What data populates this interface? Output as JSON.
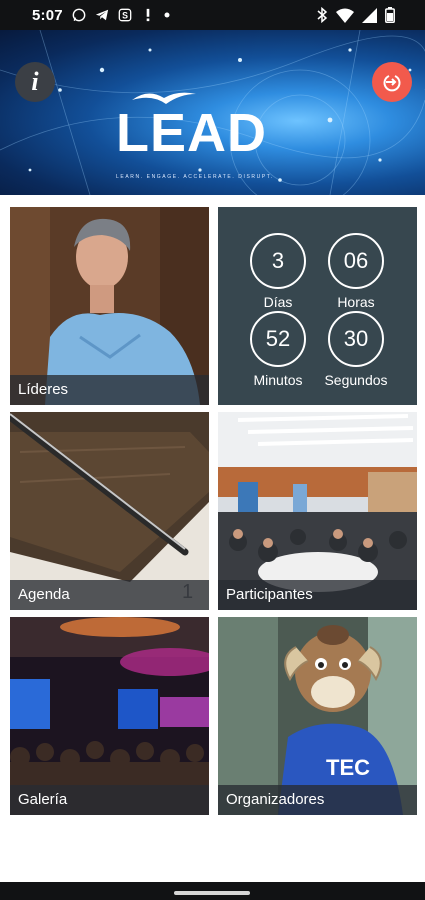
{
  "status_bar": {
    "time": "5:07",
    "left_icons": [
      "whatsapp-icon",
      "telegram-icon",
      "s-app-icon",
      "exclamation-icon",
      "dot-icon"
    ],
    "right_icons": [
      "bluetooth-icon",
      "wifi-icon",
      "signal-icon",
      "battery-icon"
    ]
  },
  "header": {
    "logo_text": "LEAD",
    "tagline": "LEARN. ENGAGE. ACCELERATE. DISRUPT.",
    "info_button": "i",
    "logout_icon": "logout-icon"
  },
  "countdown": {
    "days": "3",
    "days_label": "Días",
    "hours": "06",
    "hours_label": "Horas",
    "minutes": "52",
    "minutes_label": "Minutos",
    "seconds": "30",
    "seconds_label": "Segundos"
  },
  "tiles": {
    "lideres": "Líderes",
    "agenda": "Agenda",
    "participantes": "Participantes",
    "galeria": "Galería",
    "organizadores": "Organizadores"
  },
  "colors": {
    "countdown_bg": "#37474f",
    "logout_bg": "#f25a4c",
    "info_bg": "#3b3f45",
    "caption_bg": "rgba(40,44,50,0.78)"
  }
}
